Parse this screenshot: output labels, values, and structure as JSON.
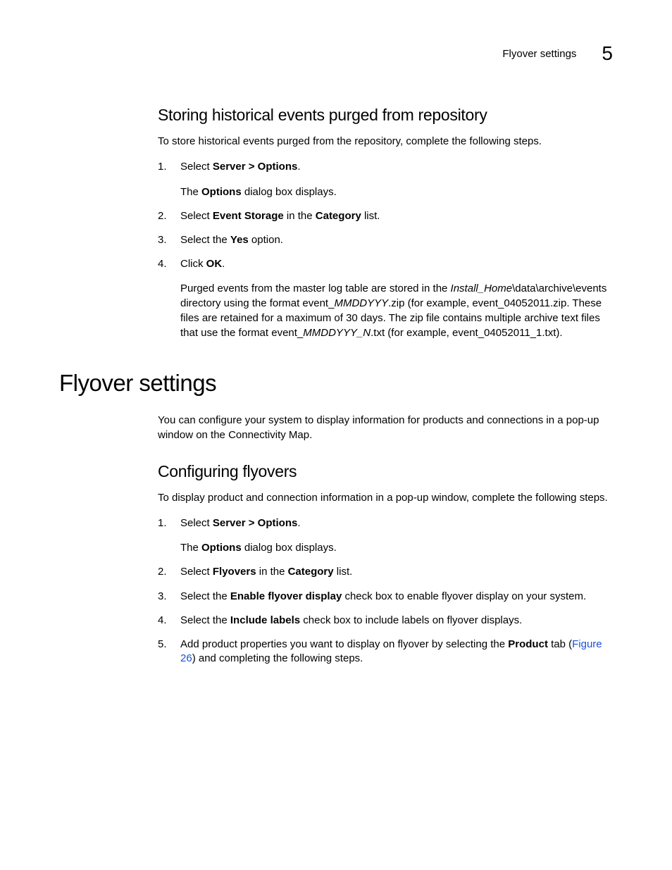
{
  "header": {
    "running_title": "Flyover settings",
    "chapter_number": "5"
  },
  "section1": {
    "heading": "Storing historical events purged from repository",
    "intro": "To store historical events purged from the repository, complete the following steps.",
    "steps": {
      "s1": {
        "pre": "Select ",
        "bold": "Server > Options",
        "post": ".",
        "sub_pre": "The ",
        "sub_bold": "Options",
        "sub_post": " dialog box displays."
      },
      "s2": {
        "pre": "Select ",
        "bold1": "Event Storage",
        "mid": " in the ",
        "bold2": "Category",
        "post": " list."
      },
      "s3": {
        "pre": "Select the ",
        "bold": "Yes",
        "post": " option."
      },
      "s4": {
        "pre": "Click ",
        "bold": "OK",
        "post": ".",
        "sub_a": "Purged events from the master log table are stored in the ",
        "sub_ital1": "Install_Home",
        "sub_b": "\\data\\archive\\events directory using the format event_",
        "sub_ital2": "MMDDYYY",
        "sub_c": ".zip (for example, event_04052011.zip. These files are retained for a maximum of 30 days. The zip file contains multiple archive text files that use the format event_",
        "sub_ital3": "MMDDYYY_N",
        "sub_d": ".txt (for example, event_04052011_1.txt)."
      }
    }
  },
  "section2": {
    "heading": "Flyover settings",
    "intro": "You can configure your system to display information for products and connections in a pop-up window on the Connectivity Map.",
    "sub_heading": "Configuring flyovers",
    "sub_intro": "To display product and connection information in a pop-up window, complete the following steps.",
    "steps": {
      "s1": {
        "pre": "Select ",
        "bold": "Server > Options",
        "post": ".",
        "sub_pre": "The ",
        "sub_bold": "Options",
        "sub_post": " dialog box displays."
      },
      "s2": {
        "pre": "Select ",
        "bold1": "Flyovers",
        "mid": " in the ",
        "bold2": "Category",
        "post": " list."
      },
      "s3": {
        "pre": "Select the ",
        "bold": "Enable flyover display",
        "post": " check box to enable flyover display on your system."
      },
      "s4": {
        "pre": "Select the ",
        "bold": "Include labels",
        "post": " check box to include labels on flyover displays."
      },
      "s5": {
        "pre": "Add product properties you want to display on flyover by selecting the ",
        "bold": "Product",
        "mid": " tab (",
        "link": "Figure 26",
        "post": ") and completing the following steps."
      }
    }
  }
}
